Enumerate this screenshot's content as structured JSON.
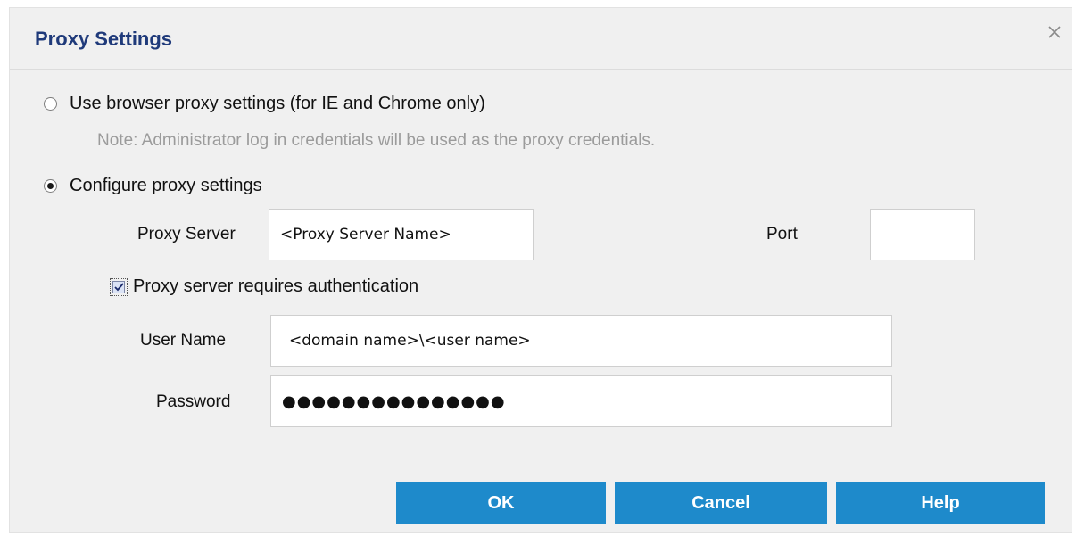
{
  "dialog": {
    "title": "Proxy Settings",
    "close_icon": "close-icon"
  },
  "options": {
    "browser_proxy": {
      "label": "Use browser proxy settings (for IE and Chrome only)",
      "selected": false
    },
    "note": "Note: Administrator log in credentials will be used as the proxy credentials.",
    "configure_proxy": {
      "label": "Configure proxy settings",
      "selected": true
    }
  },
  "proxy": {
    "server_label": "Proxy Server",
    "server_value": "<Proxy Server Name>",
    "port_label": "Port",
    "port_value": ""
  },
  "auth": {
    "checkbox_label": "Proxy server requires authentication",
    "checked": true,
    "username_label": "User Name",
    "username_value": "<domain name>\\<user name>",
    "password_label": "Password",
    "password_value": "●●●●●●●●●●●●●●●"
  },
  "buttons": {
    "ok": "OK",
    "cancel": "Cancel",
    "help": "Help"
  },
  "colors": {
    "title": "#1f3a7a",
    "button": "#1e8acb",
    "dialog_bg": "#f0f0f0"
  }
}
